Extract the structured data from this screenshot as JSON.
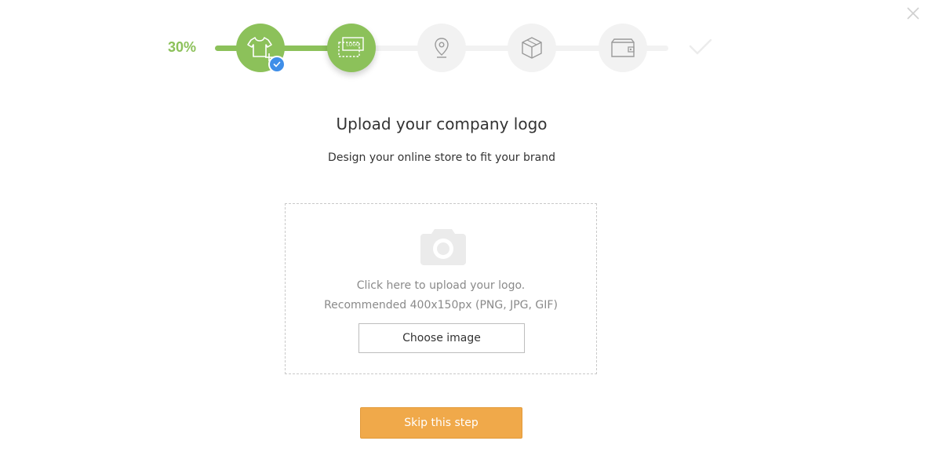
{
  "progress": {
    "percent_label": "30%",
    "percent": 30
  },
  "steps": [
    {
      "icon": "tshirt-plus-icon",
      "status": "done"
    },
    {
      "icon": "logo-upload-icon",
      "status": "active",
      "icon_text": "LOGO"
    },
    {
      "icon": "location-pin-icon",
      "status": "pending"
    },
    {
      "icon": "box-icon",
      "status": "pending"
    },
    {
      "icon": "wallet-icon",
      "status": "pending"
    },
    {
      "icon": "checkmark-icon",
      "status": "pending"
    }
  ],
  "heading": "Upload your company logo",
  "subtitle": "Design your online store to fit your brand",
  "upload": {
    "hint_line1": "Click here to upload your logo.",
    "hint_line2": "Recommended 400x150px (PNG, JPG, GIF)",
    "choose_label": "Choose image"
  },
  "skip_label": "Skip this step",
  "colors": {
    "accent_green": "#8cc15a",
    "badge_blue": "#3f8ee8",
    "skip_orange": "#f0a94a",
    "inactive_gray": "#f2f2f2"
  }
}
